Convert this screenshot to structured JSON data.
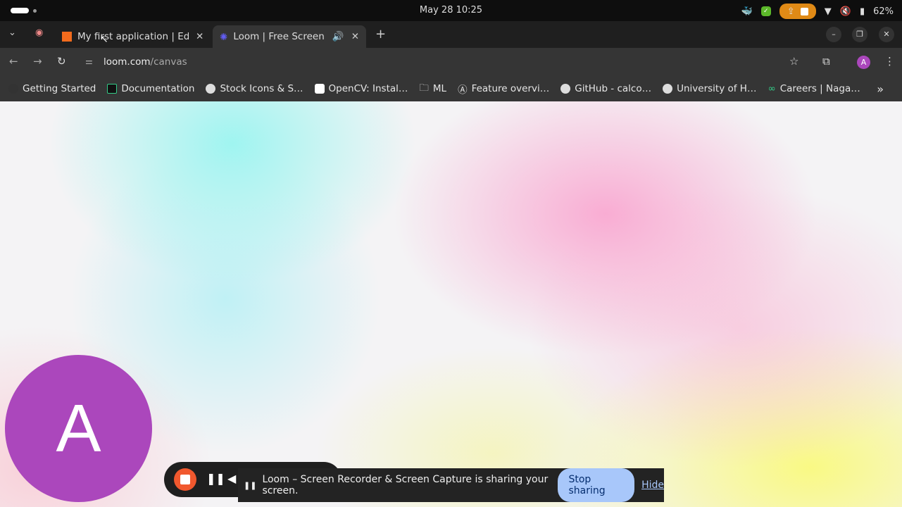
{
  "system": {
    "clock": "May 28  10:25",
    "battery": "62%"
  },
  "tabs": [
    {
      "title": "My first application | Editor",
      "favicon_color": "#f26b1d"
    },
    {
      "title": "Loom | Free Screen & Video Recording",
      "favicon_color": "#625df5"
    }
  ],
  "toolbar": {
    "url_domain": "loom.com",
    "url_path": "/canvas",
    "avatar_letter": "A"
  },
  "bookmarks": [
    "Getting Started",
    "Documentation",
    "Stock Icons & S…",
    "OpenCV: Instal…",
    "ML",
    "Feature overvi…",
    "GitHub - calco…",
    "University of H…",
    "Careers | Naga…"
  ],
  "page": {
    "camera_avatar_letter": "A"
  },
  "share_notice": {
    "text": "Loom – Screen Recorder & Screen Capture is sharing your screen.",
    "stop_label": "Stop sharing",
    "hide_label": "Hide"
  }
}
